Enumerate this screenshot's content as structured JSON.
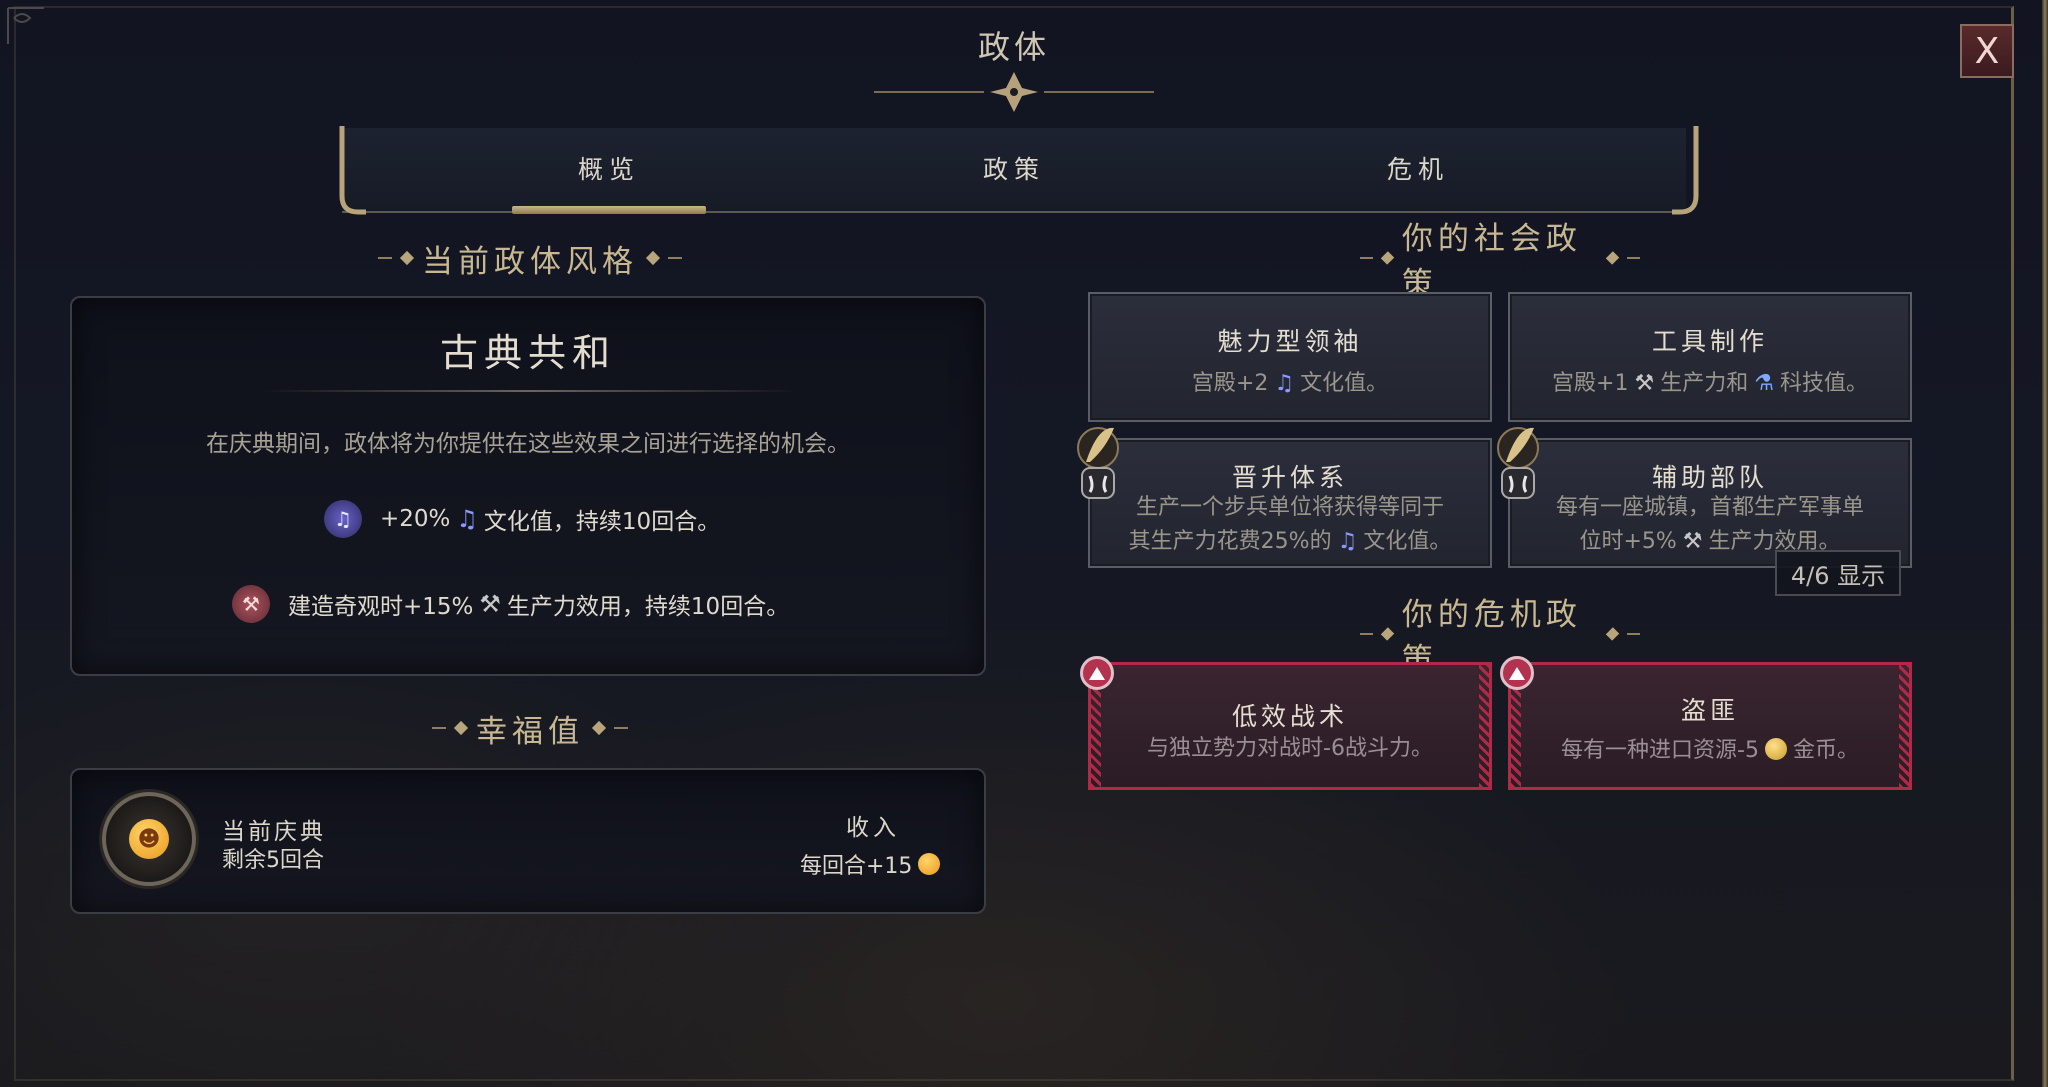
{
  "window": {
    "title": "政体",
    "close_label": "X"
  },
  "tabs": [
    {
      "label": "概览",
      "active": true
    },
    {
      "label": "政策",
      "active": false
    },
    {
      "label": "危机",
      "active": false
    }
  ],
  "overview": {
    "section_title": "当前政体风格",
    "government_name": "古典共和",
    "description": "在庆典期间，政体将为你提供在这些效果之间进行选择的机会。",
    "effects": [
      {
        "icon": "culture-icon",
        "prefix": "+20%",
        "suffix": "文化值，持续10回合。"
      },
      {
        "icon": "hammer-icon",
        "prefix": "建造奇观时+15%",
        "suffix": "生产力效用，持续10回合。"
      }
    ]
  },
  "happiness": {
    "section_title": "幸福值",
    "current_label": "当前庆典",
    "remaining": "剩余5回合",
    "income_label": "收入",
    "income_value": "每回合+15"
  },
  "social_policies": {
    "section_title": "你的社会政策",
    "count_display": "4/6 显示",
    "cards": [
      {
        "title": "魅力型领袖",
        "desc_a": "宫殿+2",
        "desc_b": "文化值。"
      },
      {
        "title": "工具制作",
        "desc_a": "宫殿+1",
        "desc_b": "生产力和",
        "desc_c": "科技值。"
      },
      {
        "title": "晋升体系",
        "line1": "生产一个步兵单位将获得等同于",
        "line2_a": "其生产力花费25%的",
        "line2_b": "文化值。"
      },
      {
        "title": "辅助部队",
        "line1": "每有一座城镇，首都生产军事单",
        "line2_a": "位时+5%",
        "line2_b": "生产力效用。"
      }
    ]
  },
  "crisis_policies": {
    "section_title": "你的危机政策",
    "cards": [
      {
        "title": "低效战术",
        "desc": "与独立势力对战时-6战斗力。"
      },
      {
        "title": "盗匪",
        "desc_a": "每有一种进口资源-5",
        "desc_b": "金币。"
      }
    ]
  },
  "colors": {
    "accent_gold": "#c8b892",
    "crisis_red": "#b02a48",
    "tab_underline": "#c9b78a",
    "culture_blue": "#7b8cff"
  }
}
